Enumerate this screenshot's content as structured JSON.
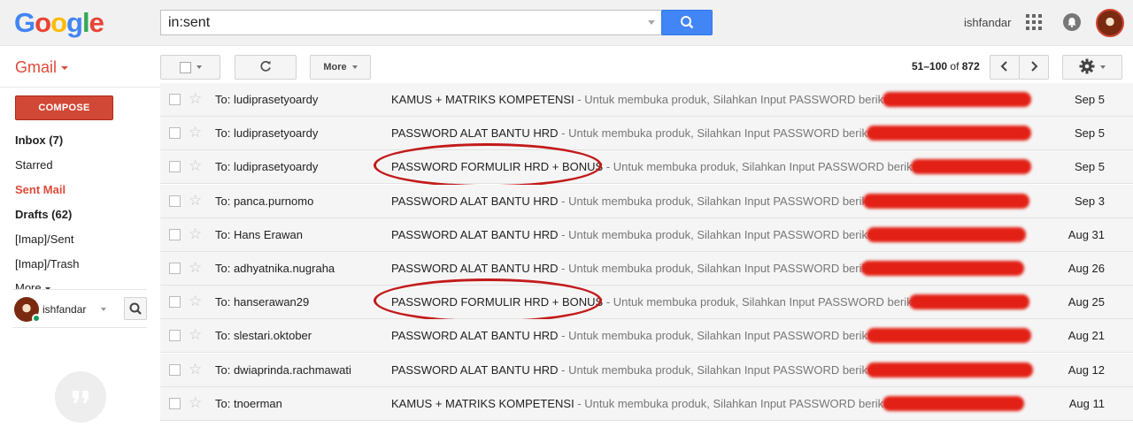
{
  "header": {
    "logo_letters": [
      {
        "ch": "G",
        "color": "#4285f4"
      },
      {
        "ch": "o",
        "color": "#ea4335"
      },
      {
        "ch": "o",
        "color": "#fbbc05"
      },
      {
        "ch": "g",
        "color": "#4285f4"
      },
      {
        "ch": "l",
        "color": "#34a853"
      },
      {
        "ch": "e",
        "color": "#ea4335"
      }
    ],
    "search_value": "in:sent",
    "username": "ishfandar"
  },
  "toolbar": {
    "app_label": "Gmail",
    "more_label": "More",
    "page_range": "51–100",
    "page_of": "of",
    "page_total": "872"
  },
  "sidebar": {
    "compose_label": "COMPOSE",
    "items": [
      {
        "label": "Inbox (7)",
        "style": "bold"
      },
      {
        "label": "Starred",
        "style": "normal"
      },
      {
        "label": "Sent Mail",
        "style": "active"
      },
      {
        "label": "Drafts (62)",
        "style": "bold"
      },
      {
        "label": "[Imap]/Sent",
        "style": "normal"
      },
      {
        "label": "[Imap]/Trash",
        "style": "normal"
      },
      {
        "label": "More",
        "style": "normal"
      }
    ],
    "hangouts_user": "ishfandar"
  },
  "emails": [
    {
      "to": "To: ludiprasetyoardy",
      "subject": "KAMUS + MATRIKS KOMPETENSI",
      "snippet": " - Untuk membuka produk, Silahkan Input PASSWORD berikut:",
      "date": "Sep 5",
      "circled": false
    },
    {
      "to": "To: ludiprasetyoardy",
      "subject": "PASSWORD ALAT BANTU HRD",
      "snippet": " - Untuk membuka produk, Silahkan Input PASSWORD berikut:",
      "date": "Sep 5",
      "circled": false
    },
    {
      "to": "To: ludiprasetyoardy",
      "subject": "PASSWORD FORMULIR HRD + BONUS",
      "snippet": " - Untuk membuka produk, Silahkan Input PASSWORD berikut:",
      "date": "Sep 5",
      "circled": true
    },
    {
      "to": "To: panca.purnomo",
      "subject": "PASSWORD ALAT BANTU HRD",
      "snippet": " - Untuk membuka produk, Silahkan Input PASSWORD berikut:",
      "date": "Sep 3",
      "circled": false
    },
    {
      "to": "To: Hans Erawan",
      "subject": "PASSWORD ALAT BANTU HRD",
      "snippet": " - Untuk membuka produk, Silahkan Input PASSWORD berikut:",
      "date": "Aug 31",
      "circled": false
    },
    {
      "to": "To: adhyatnika.nugraha",
      "subject": "PASSWORD ALAT BANTU HRD",
      "snippet": " - Untuk membuka produk, Silahkan Input PASSWORD berikut:",
      "date": "Aug 26",
      "circled": false
    },
    {
      "to": "To: hanserawan29",
      "subject": "PASSWORD FORMULIR HRD + BONUS",
      "snippet": " - Untuk membuka produk, Silahkan Input PASSWORD berikut:",
      "date": "Aug 25",
      "circled": true
    },
    {
      "to": "To: slestari.oktober",
      "subject": "PASSWORD ALAT BANTU HRD",
      "snippet": " - Untuk membuka produk, Silahkan Input PASSWORD berikut:",
      "date": "Aug 21",
      "circled": false
    },
    {
      "to": "To: dwiaprinda.rachmawati",
      "subject": "PASSWORD ALAT BANTU HRD",
      "snippet": " - Untuk membuka produk, Silahkan Input PASSWORD berikut:",
      "date": "Aug 12",
      "circled": false
    },
    {
      "to": "To: tnoerman",
      "subject": "KAMUS + MATRIKS KOMPETENSI",
      "snippet": " - Untuk membuka produk, Silahkan Input PASSWORD berikut:",
      "date": "Aug 11",
      "circled": false
    }
  ],
  "colors": {
    "brand_red": "#dd4b39",
    "search_blue": "#4285f4",
    "annotation_red": "#c31a1a",
    "redaction_red": "#e32015"
  }
}
